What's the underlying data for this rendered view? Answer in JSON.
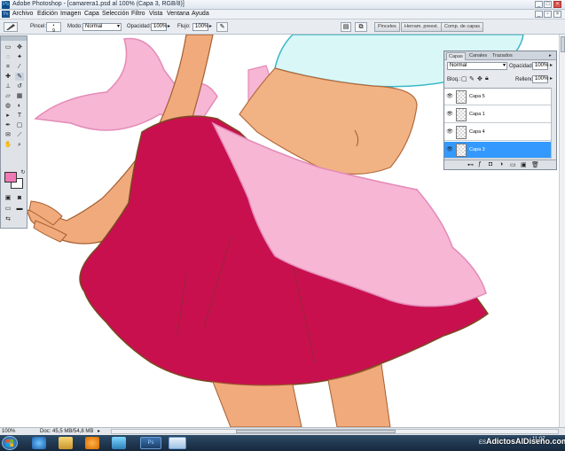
{
  "window": {
    "title": "Adobe Photoshop - [camarera1.psd al 100% (Capa 3, RGB/8)]",
    "app_icon": "Ps"
  },
  "menu": {
    "items": [
      "Archivo",
      "Edición",
      "Imagen",
      "Capa",
      "Selección",
      "Filtro",
      "Vista",
      "Ventana",
      "Ayuda"
    ]
  },
  "options": {
    "brush_label": "Pincel:",
    "brush_size": "9",
    "mode_label": "Modo:",
    "mode_value": "Normal",
    "opacity_label": "Opacidad:",
    "opacity_value": "100%",
    "flow_label": "Flujo:",
    "flow_value": "100%",
    "well_tabs": [
      "Pinceles",
      "Herram. preest.",
      "Comp. de capas"
    ]
  },
  "layers_panel": {
    "tabs": [
      "Capas",
      "Canales",
      "Trazados"
    ],
    "blend_mode": "Normal",
    "opacity_label": "Opacidad:",
    "opacity_value": "100%",
    "lock_label": "Bloq.:",
    "fill_label": "Relleno:",
    "fill_value": "100%",
    "layers": [
      {
        "name": "Capa 5",
        "selected": false
      },
      {
        "name": "Capa 1",
        "selected": false
      },
      {
        "name": "Capa 4",
        "selected": false
      },
      {
        "name": "Capa 3",
        "selected": true
      }
    ]
  },
  "status": {
    "zoom": "100%",
    "doc_size": "Doc: 45,5 MB/54,8 MB"
  },
  "taskbar": {
    "language": "ES",
    "time": "11:07",
    "watermark": "AdictosAlDiseño.com"
  },
  "colors": {
    "foreground": "#f07ab4",
    "background": "#ffffff",
    "layer_selected": "#3399ff"
  }
}
